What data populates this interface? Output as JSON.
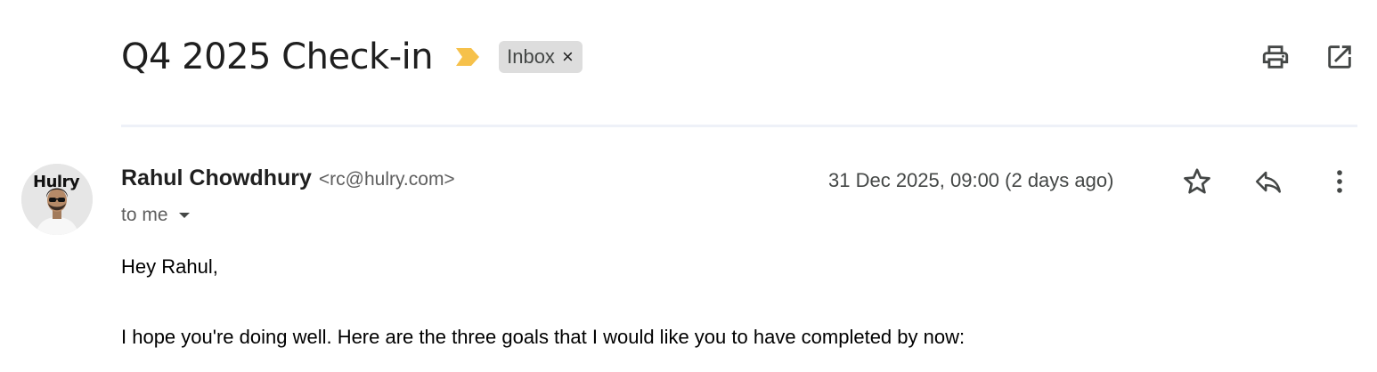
{
  "email": {
    "subject": "Q4 2025 Check-in",
    "label": "Inbox",
    "label_remove_glyph": "×",
    "importance_color": "#f6c14b",
    "sender": {
      "name": "Rahul Chowdhury",
      "email": "<rc@hulry.com>",
      "avatar_text": "Hulry"
    },
    "recipient_text": "to me",
    "date": "31 Dec 2025, 09:00 (2 days ago)",
    "body": {
      "greeting": "Hey Rahul,",
      "paragraph_1": "I hope you're doing well. Here are the three goals that I would like you to have completed by now:"
    }
  },
  "icons": {
    "print": "print-icon",
    "open_new_window": "open-in-new-window-icon",
    "star": "star-icon",
    "reply": "reply-icon",
    "more": "more-vertical-icon",
    "caret": "caret-down-icon",
    "importance": "importance-marker-icon"
  }
}
